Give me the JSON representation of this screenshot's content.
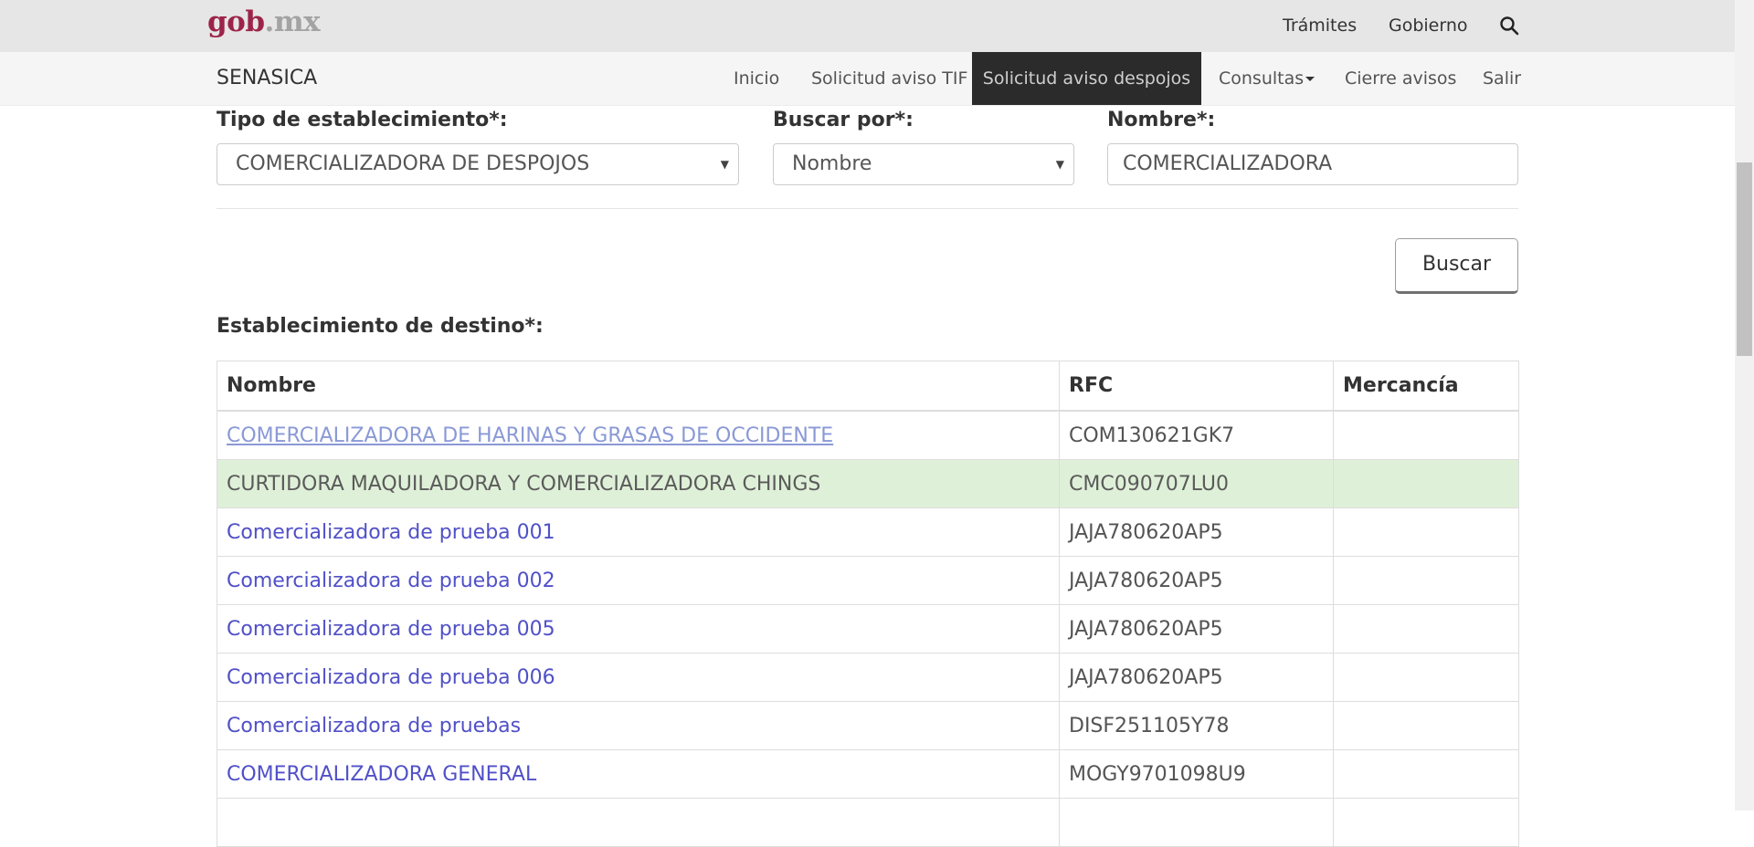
{
  "header": {
    "logo_main": "gob",
    "logo_dot": ".mx",
    "links": [
      "Trámites",
      "Gobierno"
    ],
    "search_icon": "search-icon"
  },
  "navbar": {
    "brand": "SENASICA",
    "items": [
      {
        "label": "Inicio",
        "active": false
      },
      {
        "label": "Solicitud aviso TIF",
        "active": false
      },
      {
        "label": "Solicitud aviso despojos",
        "active": true
      },
      {
        "label": "Consultas",
        "active": false,
        "dropdown": true
      },
      {
        "label": "Cierre avisos",
        "active": false
      },
      {
        "label": "Salir",
        "active": false
      }
    ]
  },
  "form": {
    "tipo_label": "Tipo de establecimiento*:",
    "tipo_value": "COMERCIALIZADORA DE DESPOJOS",
    "buscar_label": "Buscar por*:",
    "buscar_value": "Nombre",
    "nombre_label": "Nombre*:",
    "nombre_value": "COMERCIALIZADORA",
    "buscar_button": "Buscar"
  },
  "results": {
    "title": "Establecimiento de destino*:",
    "columns": [
      "Nombre",
      "RFC",
      "Mercancía"
    ],
    "rows": [
      {
        "nombre": "COMERCIALIZADORA DE HARINAS Y GRASAS DE OCCIDENTE",
        "rfc": "COM130621GK7",
        "mercancia": ""
      },
      {
        "nombre": "CURTIDORA MAQUILADORA Y COMERCIALIZADORA CHINGS",
        "rfc": "CMC090707LU0",
        "mercancia": ""
      },
      {
        "nombre": "Comercializadora de prueba 001",
        "rfc": "JAJA780620AP5",
        "mercancia": ""
      },
      {
        "nombre": "Comercializadora de prueba 002",
        "rfc": "JAJA780620AP5",
        "mercancia": ""
      },
      {
        "nombre": "Comercializadora de prueba 005",
        "rfc": "JAJA780620AP5",
        "mercancia": ""
      },
      {
        "nombre": "Comercializadora de prueba 006",
        "rfc": "JAJA780620AP5",
        "mercancia": ""
      },
      {
        "nombre": "Comercializadora de pruebas",
        "rfc": "DISF251105Y78",
        "mercancia": ""
      },
      {
        "nombre": "COMERCIALIZADORA GENERAL",
        "rfc": "MOGY9701098U9",
        "mercancia": ""
      },
      {
        "nombre": "",
        "rfc": "",
        "mercancia": ""
      }
    ]
  },
  "colors": {
    "brand": "#9d2449",
    "nav_active_bg": "#2b2b2b",
    "link": "#5050c8",
    "selected_row": "#dff0d8"
  }
}
